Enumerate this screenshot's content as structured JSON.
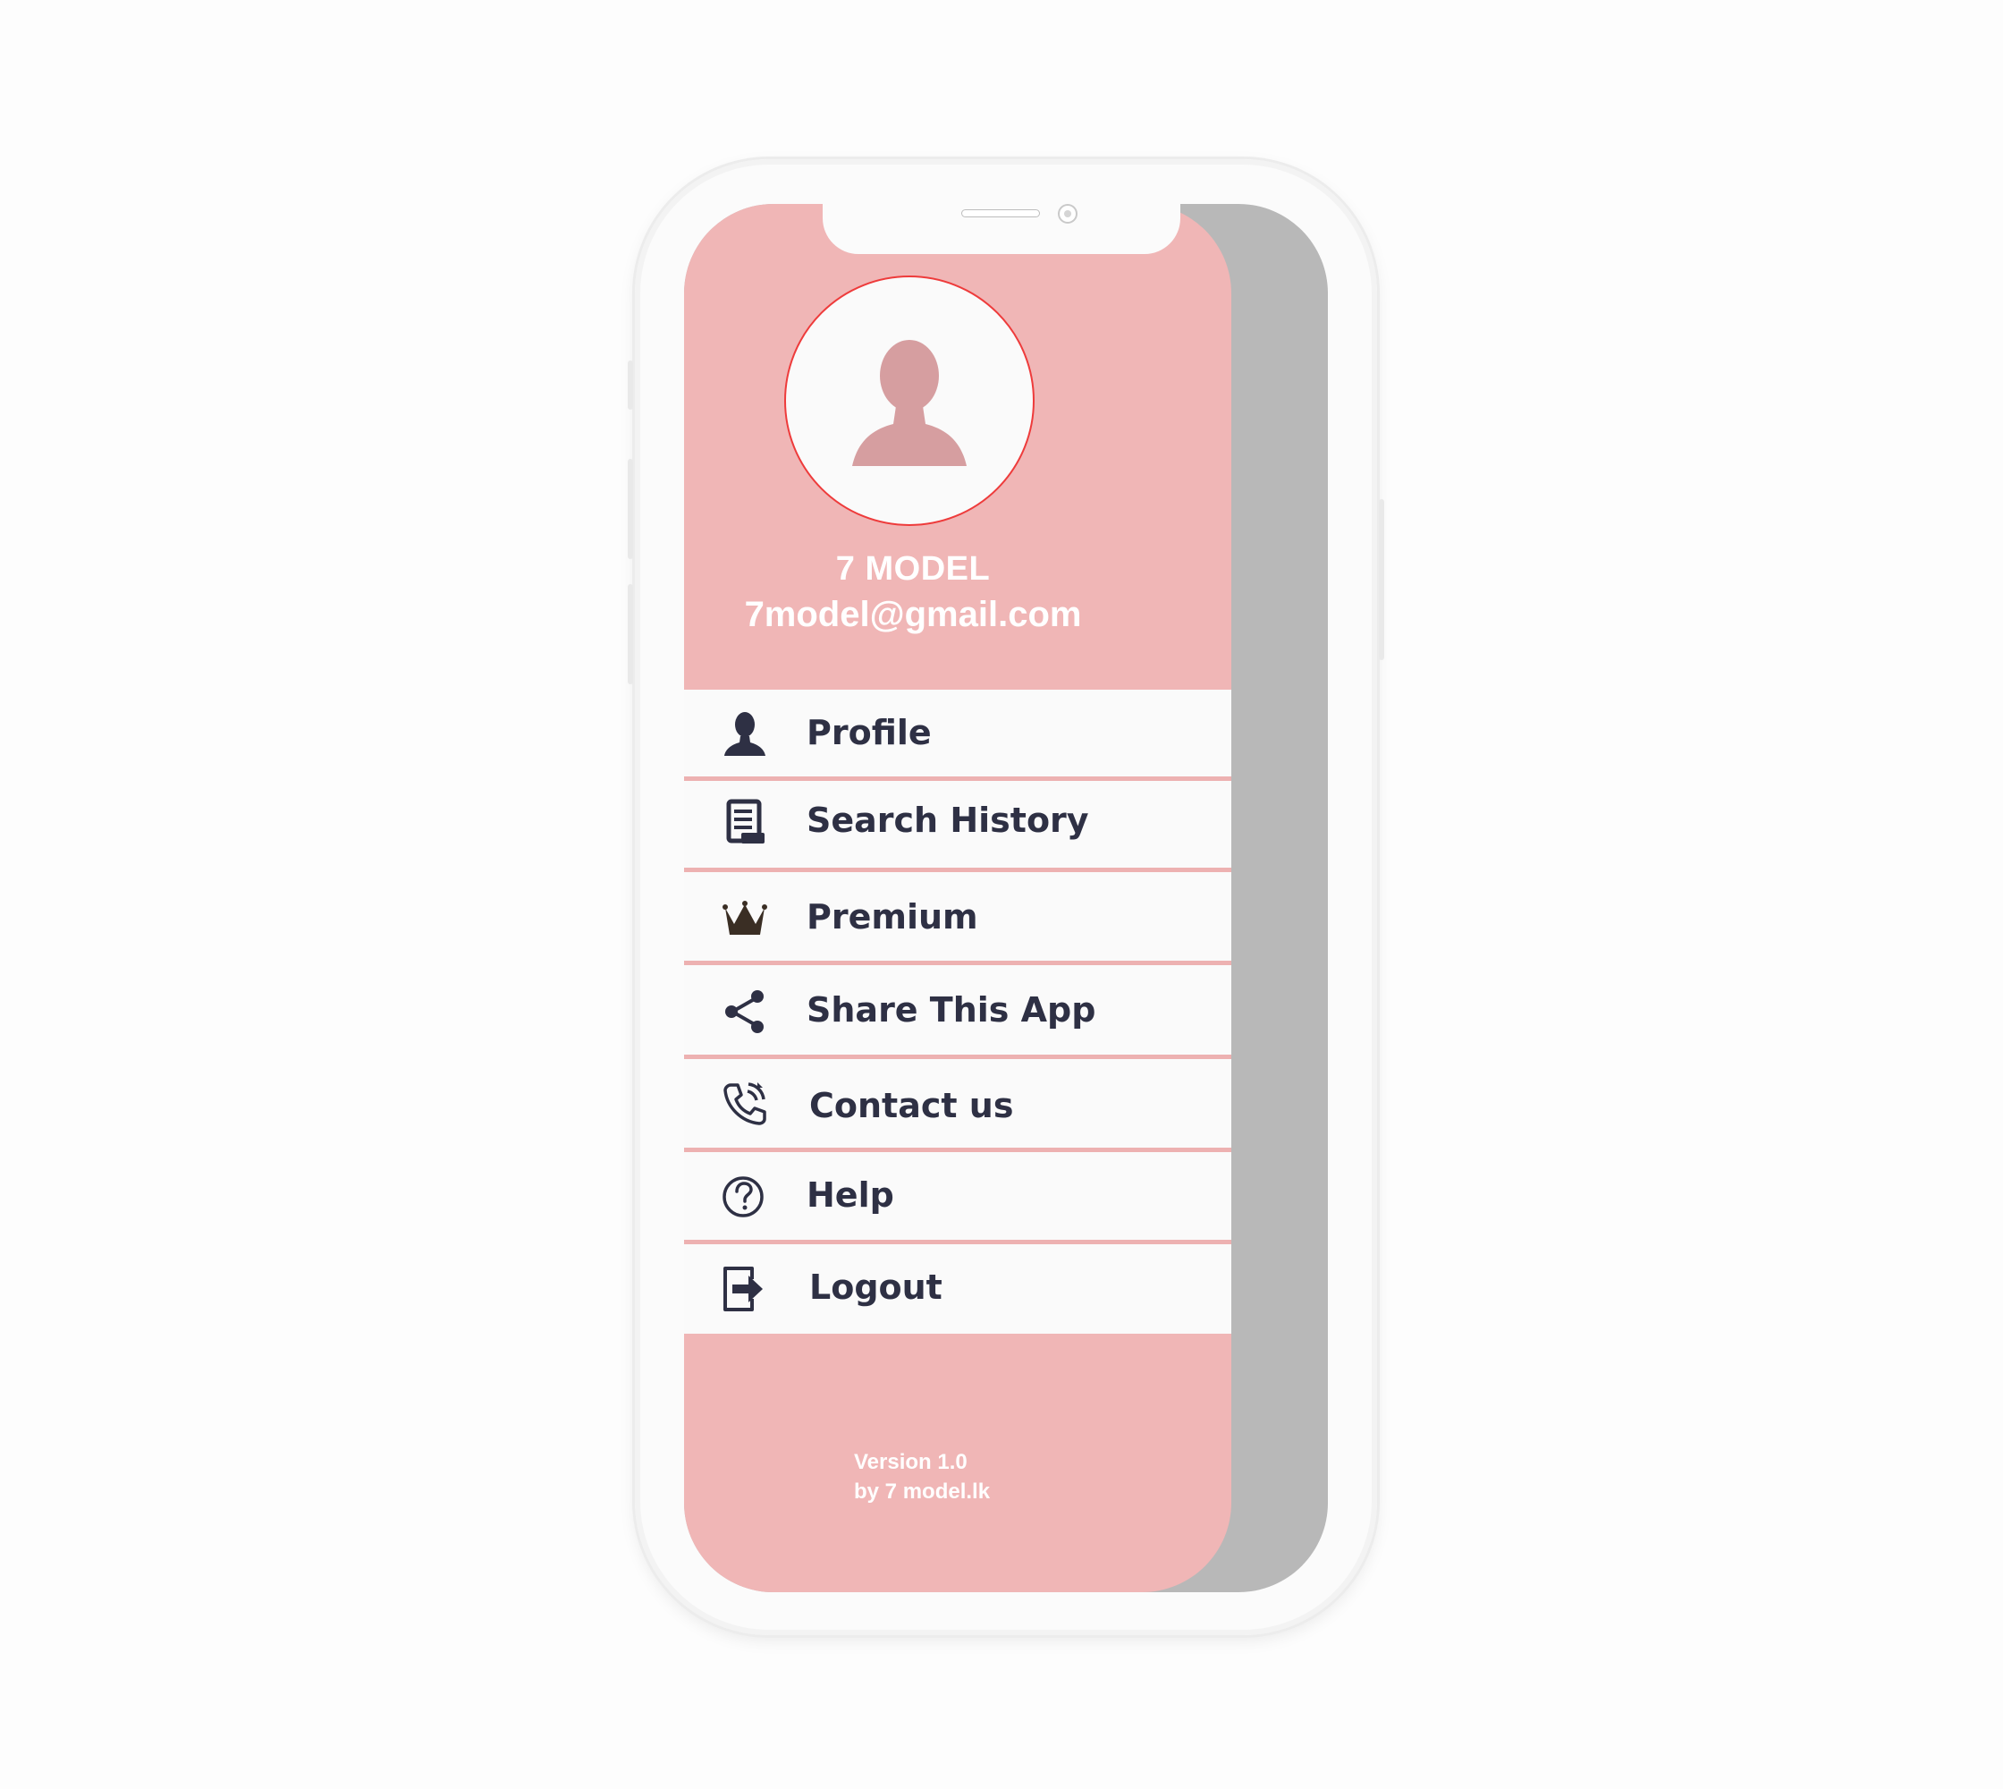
{
  "profile": {
    "name": "7 MODEL",
    "email": "7model@gmail.com",
    "avatar_icon": "person-silhouette-icon"
  },
  "menu": {
    "items": [
      {
        "label": "Profile",
        "icon": "person-icon"
      },
      {
        "label": "Search History",
        "icon": "history-list-icon"
      },
      {
        "label": "Premium",
        "icon": "crown-icon"
      },
      {
        "label": "Share This App",
        "icon": "share-icon"
      },
      {
        "label": "Contact us",
        "icon": "phone-call-icon"
      },
      {
        "label": "Help",
        "icon": "help-circle-icon"
      },
      {
        "label": "Logout",
        "icon": "logout-icon"
      }
    ]
  },
  "footer": {
    "version": "Version 1.0",
    "credit": "by 7 model.lk"
  },
  "colors": {
    "drawer_background": "#f0b6b6",
    "menu_background": "#fafafa",
    "divider": "#edb1b1",
    "label_text": "#2e3044",
    "avatar_border": "#ee3b3b",
    "overlay": "#b8b8b8"
  }
}
